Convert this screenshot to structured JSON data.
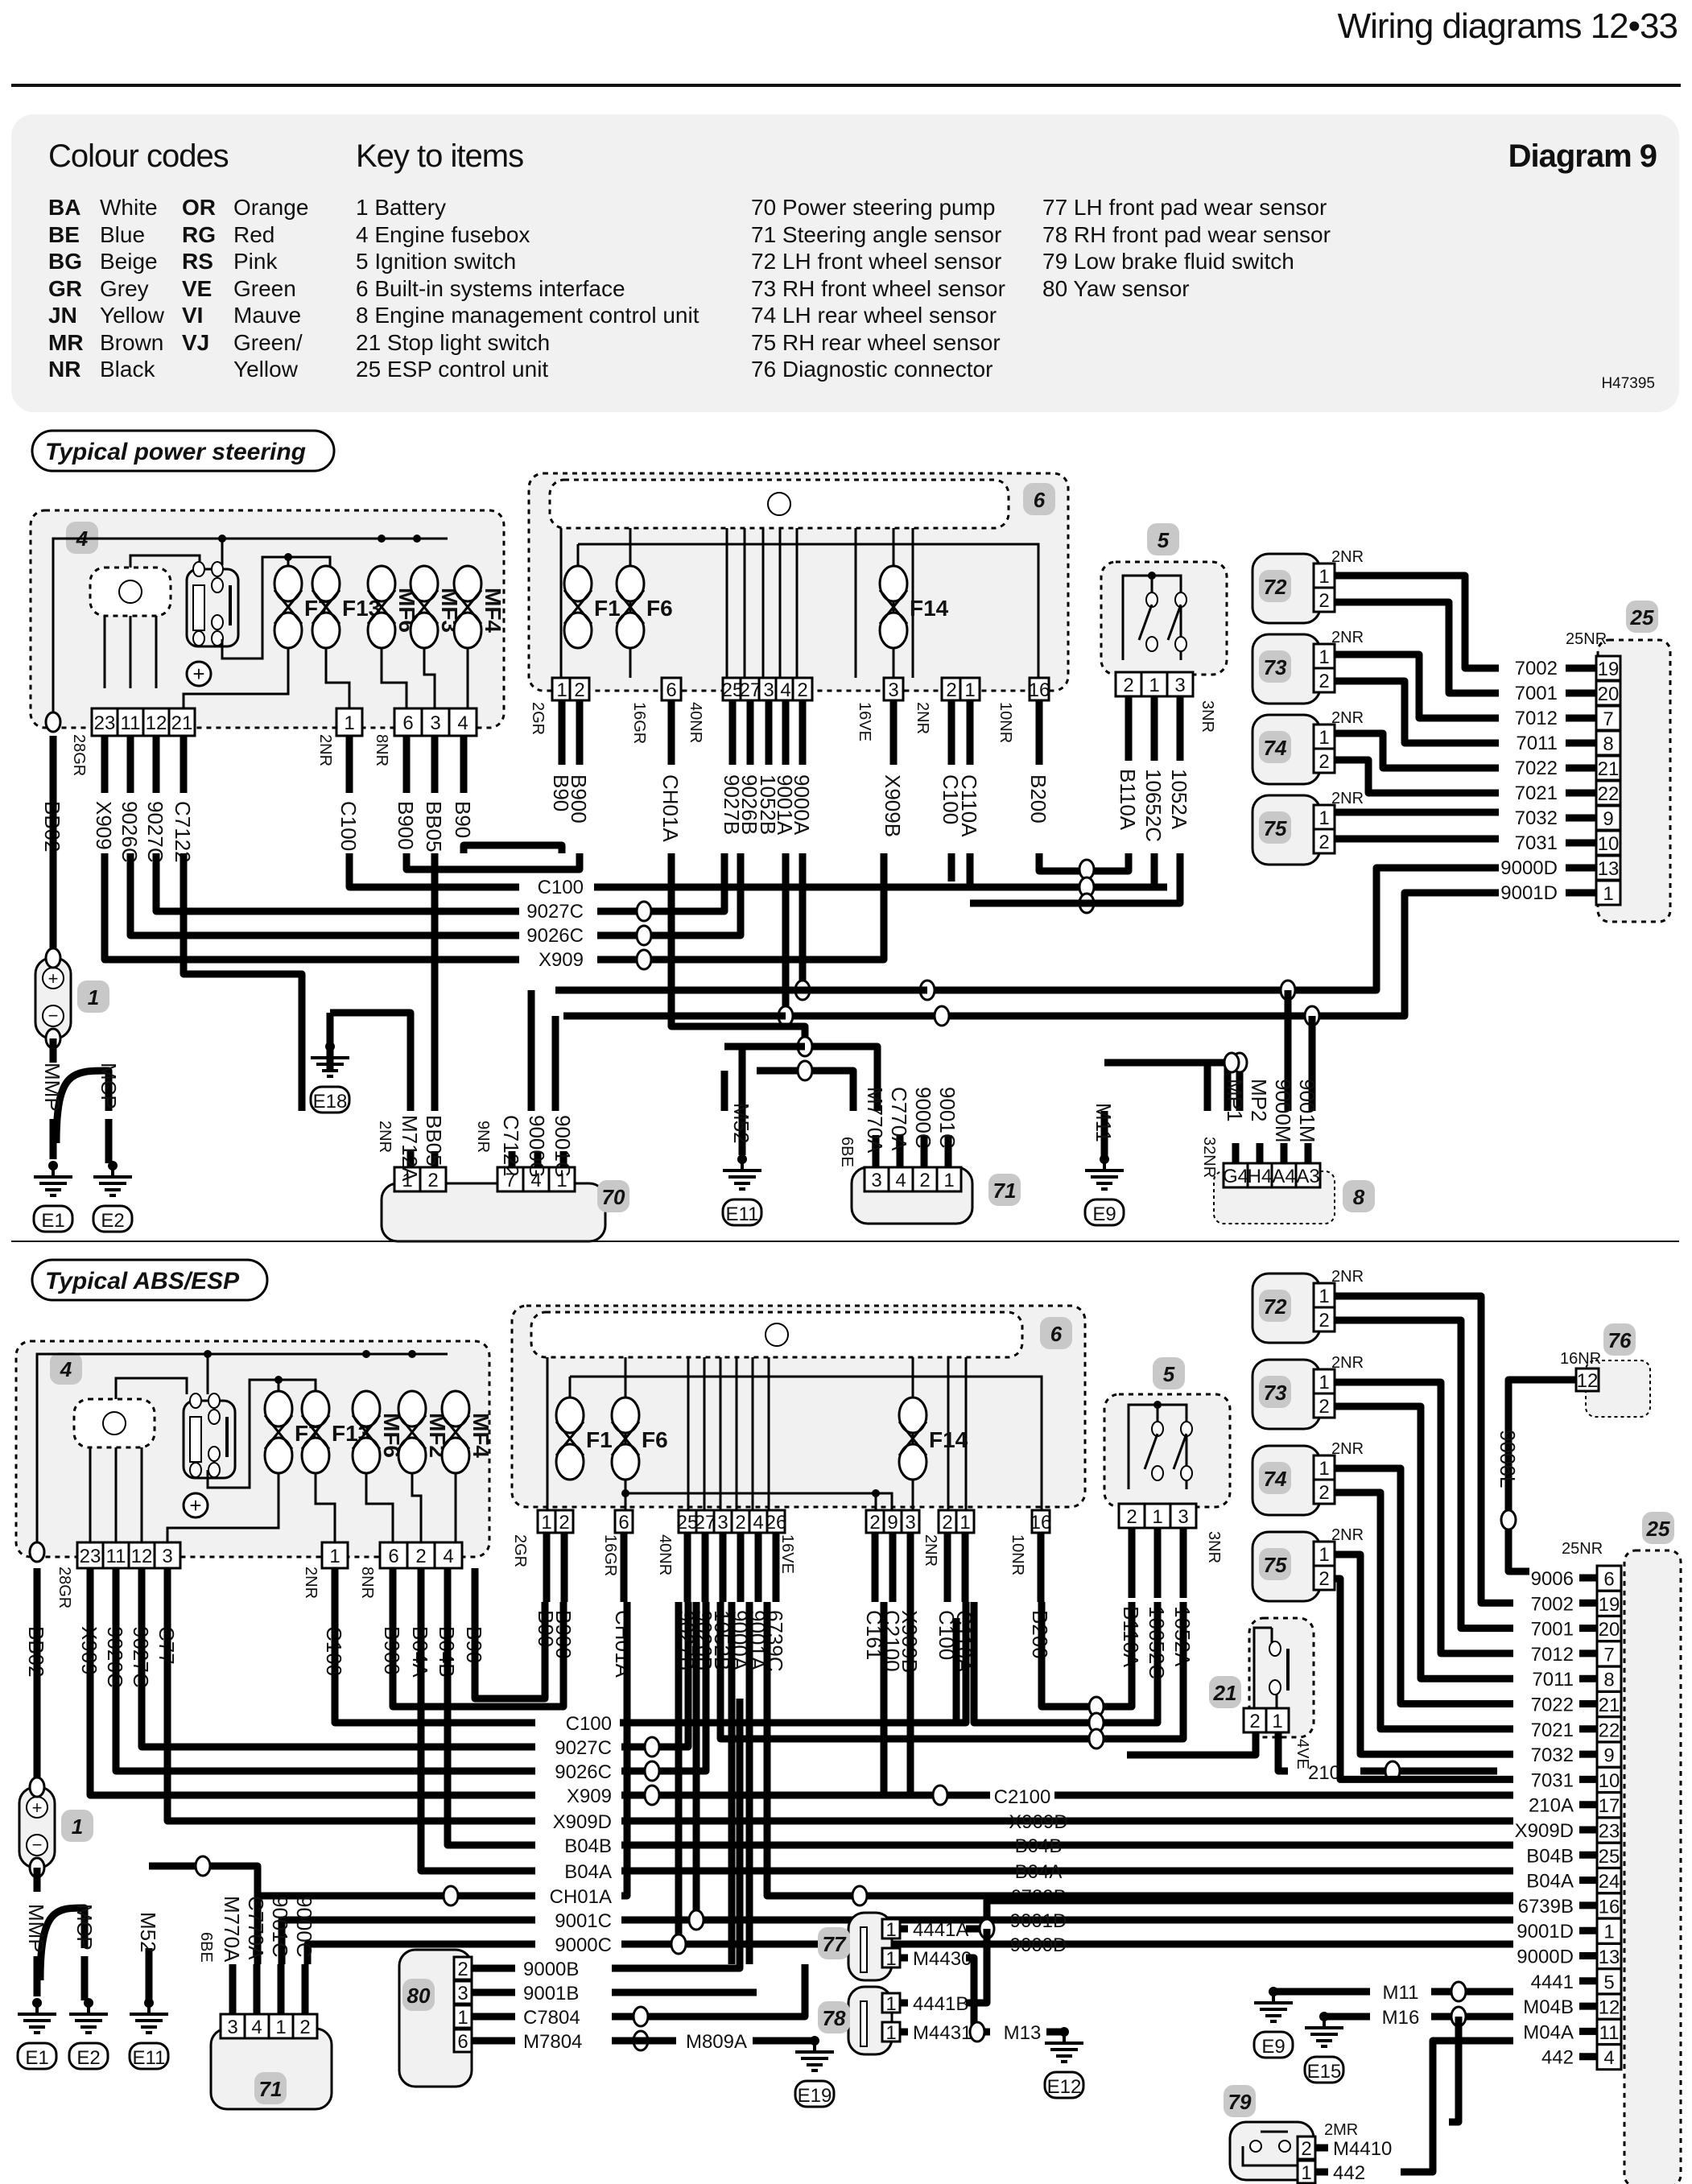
{
  "header": {
    "title": "Wiring diagrams  12•33"
  },
  "key_panel": {
    "colour_heading": "Colour codes",
    "items_heading": "Key to items",
    "diagram_label": "Diagram 9",
    "ref_code": "H47395",
    "colour_codes": [
      {
        "code": "BA",
        "name": "White"
      },
      {
        "code": "BE",
        "name": "Blue"
      },
      {
        "code": "BG",
        "name": "Beige"
      },
      {
        "code": "GR",
        "name": "Grey"
      },
      {
        "code": "JN",
        "name": "Yellow"
      },
      {
        "code": "MR",
        "name": "Brown"
      },
      {
        "code": "NR",
        "name": "Black"
      },
      {
        "code": "OR",
        "name": "Orange"
      },
      {
        "code": "RG",
        "name": "Red"
      },
      {
        "code": "RS",
        "name": "Pink"
      },
      {
        "code": "VE",
        "name": "Green"
      },
      {
        "code": "VI",
        "name": "Mauve"
      },
      {
        "code": "VJ",
        "name": "Green/"
      },
      {
        "code": "",
        "name": "Yellow"
      }
    ],
    "items": [
      "1   Battery",
      "4   Engine fusebox",
      "5   Ignition switch",
      "6   Built-in systems interface",
      "8   Engine management control unit",
      "21 Stop light switch",
      "25 ESP control unit",
      "70 Power steering pump",
      "71 Steering angle sensor",
      "72 LH front wheel sensor",
      "73 RH front wheel sensor",
      "74 LH rear wheel sensor",
      "75 RH rear wheel sensor",
      "76 Diagnostic connector",
      "77 LH front pad wear sensor",
      "78 RH front pad wear sensor",
      "79 Low brake fluid switch",
      "80 Yaw sensor"
    ]
  },
  "sections": {
    "power_steering": {
      "title": "Typical power steering",
      "fusebox": {
        "id": "4",
        "fuses": [
          "F7",
          "F13",
          "MF6",
          "MF3",
          "MF4"
        ],
        "pins_left": [
          "23",
          "11",
          "12",
          "21"
        ],
        "pin_mid": "1",
        "pins_right": [
          "6",
          "3",
          "4"
        ],
        "conn_left": "28GR",
        "conn_mid": "2NR",
        "conn_right": "8NR",
        "wires": [
          "BB02",
          "X909",
          "9026C",
          "9027C",
          "C7122",
          "C100",
          "B900",
          "BB05",
          "B90"
        ]
      },
      "bsi": {
        "id": "6",
        "fuses": [
          "F1",
          "F6",
          "F14"
        ],
        "pins": [
          "1",
          "2",
          "6",
          "25",
          "27",
          "3",
          "4",
          "2",
          "3",
          "2",
          "1",
          "16"
        ],
        "conns": [
          "2GR",
          "16GR",
          "40NR",
          "16VE",
          "2NR",
          "10NR"
        ],
        "wires": [
          "B90",
          "B900",
          "CH01A",
          "9027B",
          "9026B",
          "1052B",
          "9001A",
          "9000A",
          "X909B",
          "C100",
          "C110A",
          "B200"
        ]
      },
      "ignition": {
        "id": "5",
        "pins": [
          "2",
          "1",
          "3"
        ],
        "conn": "3NR",
        "wires": [
          "B110A",
          "10652C",
          "1052A"
        ]
      },
      "wheel_sensors": [
        {
          "id": "72",
          "conn": "2NR"
        },
        {
          "id": "73",
          "conn": "2NR"
        },
        {
          "id": "74",
          "conn": "2NR"
        },
        {
          "id": "75",
          "conn": "2NR"
        }
      ],
      "esp": {
        "id": "25",
        "conn": "25NR",
        "rows": [
          {
            "wire": "7002",
            "pin": "19"
          },
          {
            "wire": "7001",
            "pin": "20"
          },
          {
            "wire": "7012",
            "pin": "7"
          },
          {
            "wire": "7011",
            "pin": "8"
          },
          {
            "wire": "7022",
            "pin": "21"
          },
          {
            "wire": "7021",
            "pin": "22"
          },
          {
            "wire": "7032",
            "pin": "9"
          },
          {
            "wire": "7031",
            "pin": "10"
          },
          {
            "wire": "9000D",
            "pin": "13"
          },
          {
            "wire": "9001D",
            "pin": "1"
          }
        ]
      },
      "bus_labels": [
        "C100",
        "9027C",
        "9026C",
        "X909"
      ],
      "battery": {
        "id": "1",
        "wires": [
          "MMP",
          "MCP"
        ],
        "earths": [
          "E1",
          "E2"
        ]
      },
      "pump": {
        "id": "70",
        "pins": [
          "1",
          "2",
          "7",
          "4",
          "1"
        ],
        "conns": [
          "2NR",
          "9NR"
        ],
        "wires": [
          "M712A",
          "BB05",
          "C7122",
          "9000G",
          "9001G"
        ],
        "earth": "E18"
      },
      "steering_sensor": {
        "id": "71",
        "pins": [
          "3",
          "4",
          "2",
          "1"
        ],
        "conn": "6BE",
        "wires": [
          "M52",
          "M770A",
          "C770A",
          "9000C",
          "9001C"
        ],
        "earth": "E11"
      },
      "ecu": {
        "id": "8",
        "pins": [
          "G4",
          "H4",
          "A4",
          "A3"
        ],
        "conn": "32NR",
        "wires": [
          "M11",
          "MP1",
          "MP2",
          "9000M",
          "9001M"
        ],
        "earth": "E9"
      }
    },
    "abs_esp": {
      "title": "Typical ABS/ESP",
      "fusebox": {
        "id": "4",
        "fuses": [
          "F7",
          "F13",
          "MF6",
          "MF2",
          "MF4"
        ],
        "pins_left": [
          "23",
          "11",
          "12",
          "3"
        ],
        "pin_mid": "1",
        "pins_right": [
          "6",
          "2",
          "4"
        ],
        "conn_left": "28GR",
        "conn_mid": "2NR",
        "conn_right": "8NR",
        "wires": [
          "BB02",
          "X909",
          "9026C",
          "9027C",
          "C77",
          "C100",
          "B900",
          "B04A",
          "B04B",
          "B90"
        ]
      },
      "bsi": {
        "id": "6",
        "fuses": [
          "F1",
          "F6",
          "F14"
        ],
        "pins": [
          "1",
          "2",
          "6",
          "25",
          "27",
          "3",
          "2",
          "4",
          "26",
          "2",
          "9",
          "3",
          "2",
          "1",
          "16"
        ],
        "conns": [
          "2GR",
          "16GR",
          "40NR",
          "16VE",
          "2NR",
          "10NR"
        ],
        "wires": [
          "B90",
          "B900",
          "CH01A",
          "9027B",
          "9026B",
          "1052B",
          "9000A",
          "9001A",
          "6739C",
          "C161",
          "C2100",
          "X909B",
          "C100",
          "C110A",
          "B200"
        ]
      },
      "ignition": {
        "id": "5",
        "pins": [
          "2",
          "1",
          "3"
        ],
        "conn": "3NR",
        "wires": [
          "B110A",
          "10652C",
          "1052A"
        ]
      },
      "wheel_sensors": [
        {
          "id": "72",
          "conn": "2NR"
        },
        {
          "id": "73",
          "conn": "2NR"
        },
        {
          "id": "74",
          "conn": "2NR"
        },
        {
          "id": "75",
          "conn": "2NR"
        }
      ],
      "diag": {
        "id": "76",
        "conn": "16NR",
        "pin": "12",
        "wire": "9006L"
      },
      "stop_switch": {
        "id": "21",
        "pins": [
          "2",
          "1"
        ],
        "conn": "4VE",
        "wire": "210"
      },
      "esp": {
        "id": "25",
        "conn": "25NR",
        "rows": [
          {
            "wire": "9006",
            "pin": "6"
          },
          {
            "wire": "7002",
            "pin": "19"
          },
          {
            "wire": "7001",
            "pin": "20"
          },
          {
            "wire": "7012",
            "pin": "7"
          },
          {
            "wire": "7011",
            "pin": "8"
          },
          {
            "wire": "7022",
            "pin": "21"
          },
          {
            "wire": "7021",
            "pin": "22"
          },
          {
            "wire": "7032",
            "pin": "9"
          },
          {
            "wire": "7031",
            "pin": "10"
          },
          {
            "wire": "210A",
            "pin": "17"
          },
          {
            "wire": "X909D",
            "pin": "23"
          },
          {
            "wire": "B04B",
            "pin": "25"
          },
          {
            "wire": "B04A",
            "pin": "24"
          },
          {
            "wire": "6739B",
            "pin": "16"
          },
          {
            "wire": "9001D",
            "pin": "1"
          },
          {
            "wire": "9000D",
            "pin": "13"
          },
          {
            "wire": "4441",
            "pin": "5"
          },
          {
            "wire": "M04B",
            "pin": "12"
          },
          {
            "wire": "M04A",
            "pin": "11"
          },
          {
            "wire": "442",
            "pin": "4"
          }
        ]
      },
      "bus_labels": [
        "C100",
        "9027C",
        "9026C",
        "X909",
        "X909D",
        "B04B",
        "B04A",
        "CH01A",
        "9001C",
        "9000C"
      ],
      "mid_labels": [
        "C2100",
        "X909D",
        "B04B",
        "B04A",
        "6739B",
        "9001D",
        "9000D"
      ],
      "battery": {
        "id": "1",
        "wires": [
          "MMP",
          "MCP"
        ],
        "earths": [
          "E1",
          "E2"
        ]
      },
      "steering_sensor": {
        "id": "71",
        "pins": [
          "3",
          "4",
          "1",
          "2"
        ],
        "conn": "6BE",
        "wires": [
          "M52",
          "M770A",
          "C770A",
          "9001C",
          "9000C"
        ],
        "earth": "E11"
      },
      "yaw": {
        "id": "80",
        "rows": [
          {
            "pin": "2",
            "wire": "9000B"
          },
          {
            "pin": "3",
            "wire": "9001B"
          },
          {
            "pin": "1",
            "wire": "C7804"
          },
          {
            "pin": "6",
            "wire": "M7804"
          }
        ],
        "ground_wire": "M809A",
        "earth": "E19"
      },
      "pads": [
        {
          "id": "77",
          "rows": [
            {
              "pin": "1",
              "wire": "4441A"
            },
            {
              "pin": "1",
              "wire": "M4430"
            }
          ]
        },
        {
          "id": "78",
          "rows": [
            {
              "pin": "1",
              "wire": "4441B"
            },
            {
              "pin": "1",
              "wire": "M4431"
            }
          ]
        }
      ],
      "pad_ground": {
        "wire": "M13",
        "earth": "E12"
      },
      "brake_fluid": {
        "id": "79",
        "conn": "2MR",
        "rows": [
          {
            "pin": "2",
            "wire": "M4410"
          },
          {
            "pin": "1",
            "wire": "442"
          }
        ]
      },
      "grounds": [
        {
          "wire": "M11",
          "earth": "E9"
        },
        {
          "wire": "M16",
          "earth": "E15"
        }
      ]
    }
  }
}
